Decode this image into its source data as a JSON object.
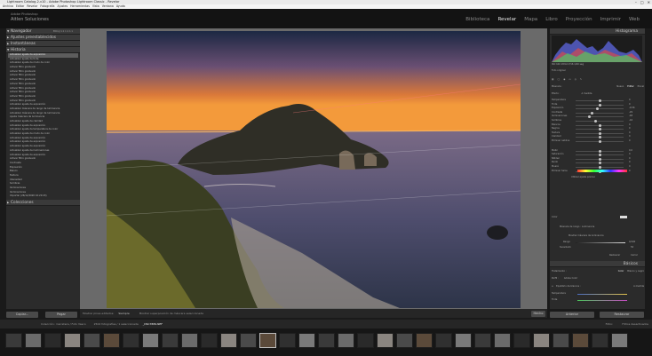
{
  "window": {
    "title": "Lightroom Catalog-2-v10 - Adobe Photoshop Lightroom Classic - Revelar",
    "controls": [
      "–",
      "□",
      "✕"
    ]
  },
  "menu": [
    "Archivo",
    "Editar",
    "Revelar",
    "Fotografía",
    "Ajustes",
    "Herramientas",
    "Vista",
    "Ventana",
    "Ayuda"
  ],
  "identity": {
    "line1": "Adobe Photoshop",
    "line2": "Aitlen Soluciones"
  },
  "modules": [
    "Biblioteca",
    "Revelar",
    "Mapa",
    "Libro",
    "Proyección",
    "Imprimir",
    "Web"
  ],
  "active_module": "Revelar",
  "left_panels": {
    "navigator": {
      "title": "Navegador",
      "zoom": "ENCAJ  1:1  1:1  1:1"
    },
    "presets": {
      "title": "Ajustes preestablecidos"
    },
    "snapshots": {
      "title": "Instantáneas"
    },
    "history": {
      "title": "Historia",
      "items": [
        "Actualizar ajuste de exposición",
        "Actualizar ajuste de tinte",
        "Actualizar ajuste de modo de color",
        "Activar filtro graduado",
        "Activar filtro graduado",
        "Activar filtro graduado",
        "Activar filtro graduado",
        "Activar filtro graduado",
        "Activar filtro graduado",
        "Activar filtro graduado",
        "Activar filtro graduado",
        "Activar filtro graduado",
        "Actualizar ajuste de exposición",
        "Actualizar máscara de rango de luminancia",
        "Actualizar máscara de rango de luminancia",
        "Ajuste máscara de luminancia",
        "Actualizar ajuste de claridad",
        "Actualizar ajuste de exposición",
        "Actualizar ajuste de temperatura de color",
        "Actualizar ajuste de modo de color",
        "Actualizar ajuste de exposición",
        "Actualizar ajuste de exposición",
        "Actualizar ajuste de exposición",
        "Actualizar ajuste de iluminaciones",
        "Actualizar ajuste de exposición",
        "Activar filtro graduado",
        "Contraste",
        "Exposición",
        "Blanco",
        "Textura",
        "Intensidad",
        "Sombras",
        "Iluminaciones",
        "Iluminaciones",
        "Importar (26/12/2020 10:20:43)"
      ]
    },
    "collections": {
      "title": "Colecciones"
    }
  },
  "left_buttons": {
    "copy": "Copiar...",
    "paste": "Pegar"
  },
  "toolbar": {
    "label1": "Mostrar pines editados:",
    "value1": "Siempre",
    "label2": "Mostrar superposición de máscara seleccionada",
    "done": "Hecho"
  },
  "right_panel": {
    "histogram": {
      "title": "Histograma",
      "info": "ISO 100    18mm    f/16    1/40 seg"
    },
    "original": "Foto original",
    "mask_label": "Máscara :",
    "mask_tabs": [
      "Nuevo",
      "Editar",
      "Pincel"
    ],
    "effect": "Efecto :",
    "effect_value": "A medida",
    "sliders": [
      {
        "label": "Temperatura",
        "value": "0",
        "pos": 0.5
      },
      {
        "label": "Tinte",
        "value": "0",
        "pos": 0.5
      },
      {
        "label": "Exposición",
        "value": "-0,56",
        "pos": 0.45
      },
      {
        "label": "Contraste",
        "value": "-29",
        "pos": 0.35
      },
      {
        "label": "Iluminaciones",
        "value": "-48",
        "pos": 0.28
      },
      {
        "label": "Sombras",
        "value": "-16",
        "pos": 0.42
      },
      {
        "label": "Blancos",
        "value": "0",
        "pos": 0.5
      },
      {
        "label": "Negros",
        "value": "0",
        "pos": 0.5
      },
      {
        "label": "Textura",
        "value": "0",
        "pos": 0.5
      },
      {
        "label": "Claridad",
        "value": "0",
        "pos": 0.5
      },
      {
        "label": "Eliminar neblina",
        "value": "0",
        "pos": 0.5
      },
      {
        "label": "Matiz",
        "value": "0,0",
        "pos": 0.5
      },
      {
        "label": "Saturación",
        "value": "0",
        "pos": 0.5
      },
      {
        "label": "Nitidez",
        "value": "0",
        "pos": 0.5
      },
      {
        "label": "Ruido",
        "value": "0",
        "pos": 0.5
      },
      {
        "label": "Muaré",
        "value": "0",
        "pos": 0.5
      },
      {
        "label": "Eliminar halos",
        "value": "0",
        "pos": 0.5
      }
    ],
    "hue_check": "Utilizar ajuste preciso",
    "color": "Color",
    "range_title": "Máscara de rango :  Luminancia",
    "range_show": "Mostrar máscara de luminancia",
    "range_label": "Rango",
    "smooth_label": "Suavizado",
    "range_value": "0/100",
    "smooth_value": "50",
    "reset": "Restaurar",
    "close": "Cerrar",
    "basic": "Básicos",
    "treatment": "Tratamiento :",
    "treat_opts": [
      "Color",
      "Blanco y negro"
    ],
    "profile": "Perfil :",
    "profile_value": "Adobe Color",
    "wb": "Equilibrio de blancos :",
    "wb_value": "A medida",
    "temp": "Temperatura",
    "tint": "Tinte",
    "prev": "Anterior",
    "restore": "Restaurar"
  },
  "filmstrip": {
    "source": "Colección : Carretera / Foto Vasco",
    "count": "2502 fotografías / 1 seleccionada",
    "file": "_DSC7889.NEF",
    "filter": "Filtro:",
    "filter_value": "Filtros desactivados",
    "thumbs": 32,
    "selected_index": 13
  },
  "colors": {
    "accent": "#8fb3d9",
    "sky_top": "#1b2540",
    "sky_sun": "#f08a2a"
  }
}
